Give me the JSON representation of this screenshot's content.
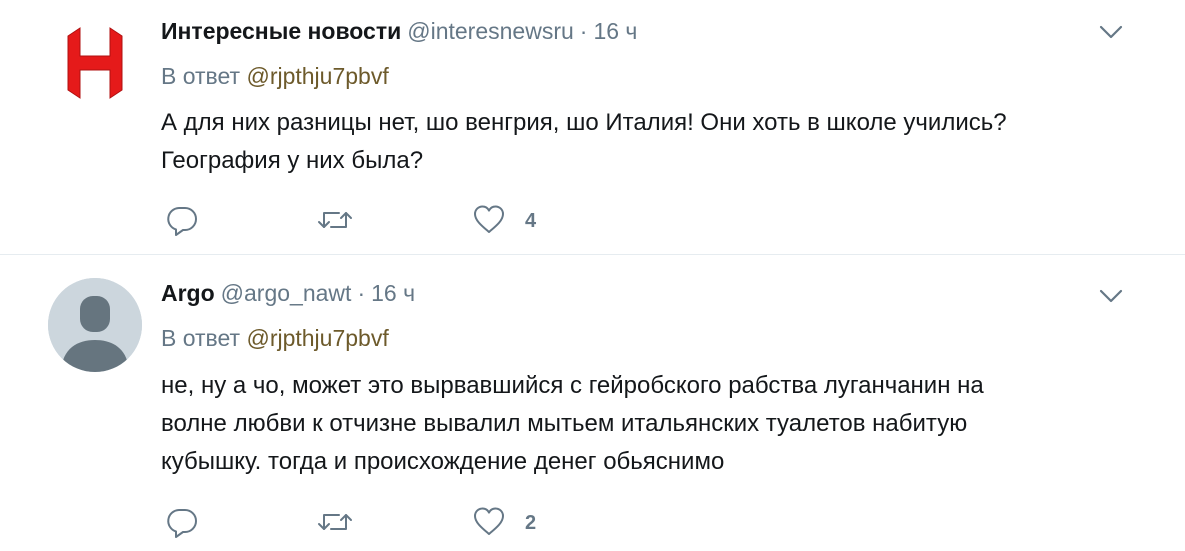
{
  "tweets": [
    {
      "author": {
        "name": "Интересные новости",
        "handle": "@interesnewsru",
        "avatar_icon": "red-letter-h-logo"
      },
      "separator": "·",
      "time": "16 ч",
      "reply_label": "В ответ",
      "reply_mention": "@rjpthju7pbvf",
      "text_lines": [
        "А для них разницы нет, шо венгрия, шо Италия! Они хоть в школе учились?",
        "География у них была?"
      ],
      "likes": "4"
    },
    {
      "author": {
        "name": "Argo",
        "handle": "@argo_nawt",
        "avatar_icon": "default-user-icon"
      },
      "separator": "·",
      "time": "16 ч",
      "reply_label": "В ответ",
      "reply_mention": "@rjpthju7pbvf",
      "text_lines": [
        "не, ну а чо, может это вырвавшийся с гейробского рабства луганчанин на",
        "волне любви к отчизне вывалил мытьем итальянских туалетов набитую",
        "кубышку. тогда и происхождение денег обьяснимо"
      ],
      "likes": "2"
    }
  ],
  "colors": {
    "text": "#14171a",
    "secondary": "#657786",
    "mention": "#6d5a2b",
    "divider": "#e6ecf0",
    "logo_red": "#e51a1a",
    "default_avatar_bg": "#ccd6dd",
    "default_avatar_fg": "#66757f"
  }
}
